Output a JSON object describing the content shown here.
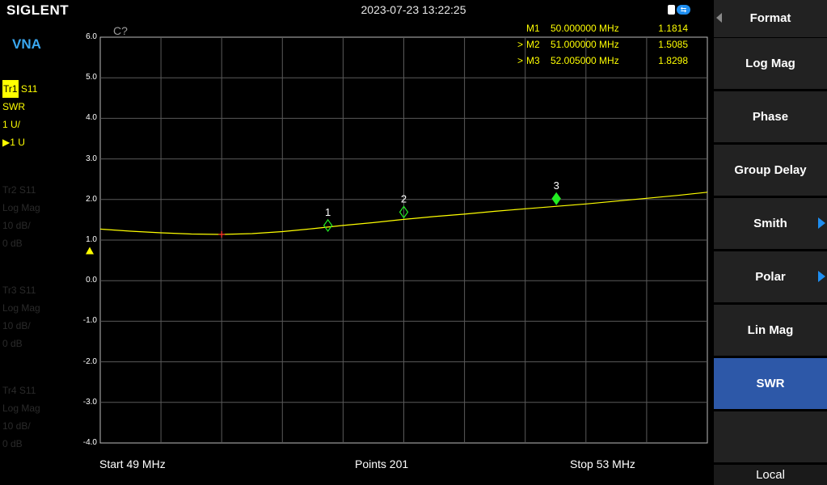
{
  "header": {
    "brand": "SIGLENT",
    "datetime": "2023-07-23 13:22:25",
    "usb_icon": "usb-icon"
  },
  "mode": "VNA",
  "traces": [
    {
      "tag": "Tr1",
      "param": "S11",
      "format": "SWR",
      "scale": "1 U/",
      "ref": "1 U",
      "active": true
    },
    {
      "tag": "Tr2",
      "param": "S11",
      "format": "Log Mag",
      "scale": "10 dB/",
      "ref": "0 dB",
      "active": false
    },
    {
      "tag": "Tr3",
      "param": "S11",
      "format": "Log Mag",
      "scale": "10 dB/",
      "ref": "0 dB",
      "active": false
    },
    {
      "tag": "Tr4",
      "param": "S11",
      "format": "Log Mag",
      "scale": "10 dB/",
      "ref": "0 dB",
      "active": false
    }
  ],
  "cal_status": "C?",
  "markers": [
    {
      "pointer": "",
      "name": "M1",
      "freq": "50.000000 MHz",
      "value": "1.1814"
    },
    {
      "pointer": ">",
      "name": "M2",
      "freq": "51.000000 MHz",
      "value": "1.5085"
    },
    {
      "pointer": ">",
      "name": "M3",
      "freq": "52.005000 MHz",
      "value": "1.8298"
    }
  ],
  "footer": {
    "start": "Start  49 MHz",
    "points": "Points  201",
    "stop": "Stop  53 MHz"
  },
  "menu": {
    "title": "Format",
    "items": [
      {
        "label": "Log Mag",
        "submenu": false,
        "active": false
      },
      {
        "label": "Phase",
        "submenu": false,
        "active": false
      },
      {
        "label": "Group Delay",
        "submenu": false,
        "active": false
      },
      {
        "label": "Smith",
        "submenu": true,
        "active": false
      },
      {
        "label": "Polar",
        "submenu": true,
        "active": false
      },
      {
        "label": "Lin Mag",
        "submenu": false,
        "active": false
      },
      {
        "label": "SWR",
        "submenu": false,
        "active": true
      }
    ],
    "local_label": "Local"
  },
  "chart_data": {
    "type": "line",
    "title": "",
    "xlabel": "",
    "ylabel": "",
    "xlim": [
      49,
      53
    ],
    "ylim": [
      -4,
      6
    ],
    "y_ticks": [
      "6.0",
      "5.0",
      "4.0",
      "3.0",
      "2.0",
      "1.0",
      "0.0",
      "-1.0",
      "-2.0",
      "-3.0",
      "-4.0"
    ],
    "grid": true,
    "series": [
      {
        "color": "#ffff00",
        "x": [
          49.0,
          49.2,
          49.4,
          49.6,
          49.8,
          50.0,
          50.2,
          50.4,
          50.6,
          50.8,
          51.0,
          51.2,
          51.4,
          51.6,
          51.8,
          52.0,
          52.2,
          52.4,
          52.6,
          52.8,
          53.0
        ],
        "y": [
          1.27,
          1.22,
          1.18,
          1.15,
          1.14,
          1.16,
          1.21,
          1.28,
          1.36,
          1.43,
          1.51,
          1.58,
          1.64,
          1.71,
          1.77,
          1.83,
          1.89,
          1.96,
          2.03,
          2.1,
          2.18
        ]
      }
    ],
    "markers": [
      {
        "label": "1",
        "x": 50.5,
        "y": 1.36,
        "active": false
      },
      {
        "label": "2",
        "x": 51.0,
        "y": 1.69,
        "active": false
      },
      {
        "label": "3",
        "x": 52.005,
        "y": 2.02,
        "active": true
      }
    ],
    "min_point": {
      "x": 49.8,
      "y": 1.14
    },
    "ref_marker": {
      "y": 0.75
    }
  }
}
